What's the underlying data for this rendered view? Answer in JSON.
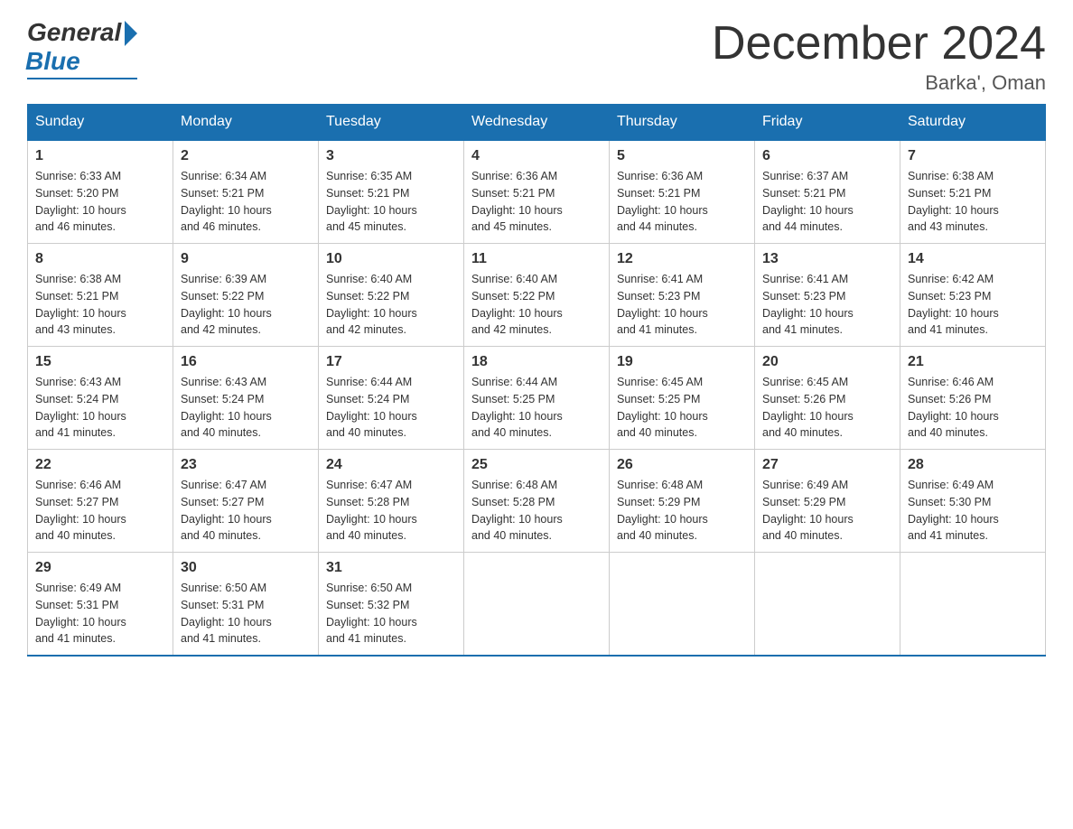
{
  "logo": {
    "general": "General",
    "blue": "Blue"
  },
  "title": "December 2024",
  "location": "Barka', Oman",
  "days_of_week": [
    "Sunday",
    "Monday",
    "Tuesday",
    "Wednesday",
    "Thursday",
    "Friday",
    "Saturday"
  ],
  "weeks": [
    [
      {
        "day": "1",
        "sunrise": "6:33 AM",
        "sunset": "5:20 PM",
        "daylight": "10 hours and 46 minutes."
      },
      {
        "day": "2",
        "sunrise": "6:34 AM",
        "sunset": "5:21 PM",
        "daylight": "10 hours and 46 minutes."
      },
      {
        "day": "3",
        "sunrise": "6:35 AM",
        "sunset": "5:21 PM",
        "daylight": "10 hours and 45 minutes."
      },
      {
        "day": "4",
        "sunrise": "6:36 AM",
        "sunset": "5:21 PM",
        "daylight": "10 hours and 45 minutes."
      },
      {
        "day": "5",
        "sunrise": "6:36 AM",
        "sunset": "5:21 PM",
        "daylight": "10 hours and 44 minutes."
      },
      {
        "day": "6",
        "sunrise": "6:37 AM",
        "sunset": "5:21 PM",
        "daylight": "10 hours and 44 minutes."
      },
      {
        "day": "7",
        "sunrise": "6:38 AM",
        "sunset": "5:21 PM",
        "daylight": "10 hours and 43 minutes."
      }
    ],
    [
      {
        "day": "8",
        "sunrise": "6:38 AM",
        "sunset": "5:21 PM",
        "daylight": "10 hours and 43 minutes."
      },
      {
        "day": "9",
        "sunrise": "6:39 AM",
        "sunset": "5:22 PM",
        "daylight": "10 hours and 42 minutes."
      },
      {
        "day": "10",
        "sunrise": "6:40 AM",
        "sunset": "5:22 PM",
        "daylight": "10 hours and 42 minutes."
      },
      {
        "day": "11",
        "sunrise": "6:40 AM",
        "sunset": "5:22 PM",
        "daylight": "10 hours and 42 minutes."
      },
      {
        "day": "12",
        "sunrise": "6:41 AM",
        "sunset": "5:23 PM",
        "daylight": "10 hours and 41 minutes."
      },
      {
        "day": "13",
        "sunrise": "6:41 AM",
        "sunset": "5:23 PM",
        "daylight": "10 hours and 41 minutes."
      },
      {
        "day": "14",
        "sunrise": "6:42 AM",
        "sunset": "5:23 PM",
        "daylight": "10 hours and 41 minutes."
      }
    ],
    [
      {
        "day": "15",
        "sunrise": "6:43 AM",
        "sunset": "5:24 PM",
        "daylight": "10 hours and 41 minutes."
      },
      {
        "day": "16",
        "sunrise": "6:43 AM",
        "sunset": "5:24 PM",
        "daylight": "10 hours and 40 minutes."
      },
      {
        "day": "17",
        "sunrise": "6:44 AM",
        "sunset": "5:24 PM",
        "daylight": "10 hours and 40 minutes."
      },
      {
        "day": "18",
        "sunrise": "6:44 AM",
        "sunset": "5:25 PM",
        "daylight": "10 hours and 40 minutes."
      },
      {
        "day": "19",
        "sunrise": "6:45 AM",
        "sunset": "5:25 PM",
        "daylight": "10 hours and 40 minutes."
      },
      {
        "day": "20",
        "sunrise": "6:45 AM",
        "sunset": "5:26 PM",
        "daylight": "10 hours and 40 minutes."
      },
      {
        "day": "21",
        "sunrise": "6:46 AM",
        "sunset": "5:26 PM",
        "daylight": "10 hours and 40 minutes."
      }
    ],
    [
      {
        "day": "22",
        "sunrise": "6:46 AM",
        "sunset": "5:27 PM",
        "daylight": "10 hours and 40 minutes."
      },
      {
        "day": "23",
        "sunrise": "6:47 AM",
        "sunset": "5:27 PM",
        "daylight": "10 hours and 40 minutes."
      },
      {
        "day": "24",
        "sunrise": "6:47 AM",
        "sunset": "5:28 PM",
        "daylight": "10 hours and 40 minutes."
      },
      {
        "day": "25",
        "sunrise": "6:48 AM",
        "sunset": "5:28 PM",
        "daylight": "10 hours and 40 minutes."
      },
      {
        "day": "26",
        "sunrise": "6:48 AM",
        "sunset": "5:29 PM",
        "daylight": "10 hours and 40 minutes."
      },
      {
        "day": "27",
        "sunrise": "6:49 AM",
        "sunset": "5:29 PM",
        "daylight": "10 hours and 40 minutes."
      },
      {
        "day": "28",
        "sunrise": "6:49 AM",
        "sunset": "5:30 PM",
        "daylight": "10 hours and 41 minutes."
      }
    ],
    [
      {
        "day": "29",
        "sunrise": "6:49 AM",
        "sunset": "5:31 PM",
        "daylight": "10 hours and 41 minutes."
      },
      {
        "day": "30",
        "sunrise": "6:50 AM",
        "sunset": "5:31 PM",
        "daylight": "10 hours and 41 minutes."
      },
      {
        "day": "31",
        "sunrise": "6:50 AM",
        "sunset": "5:32 PM",
        "daylight": "10 hours and 41 minutes."
      },
      null,
      null,
      null,
      null
    ]
  ],
  "labels": {
    "sunrise": "Sunrise:",
    "sunset": "Sunset:",
    "daylight": "Daylight:"
  }
}
